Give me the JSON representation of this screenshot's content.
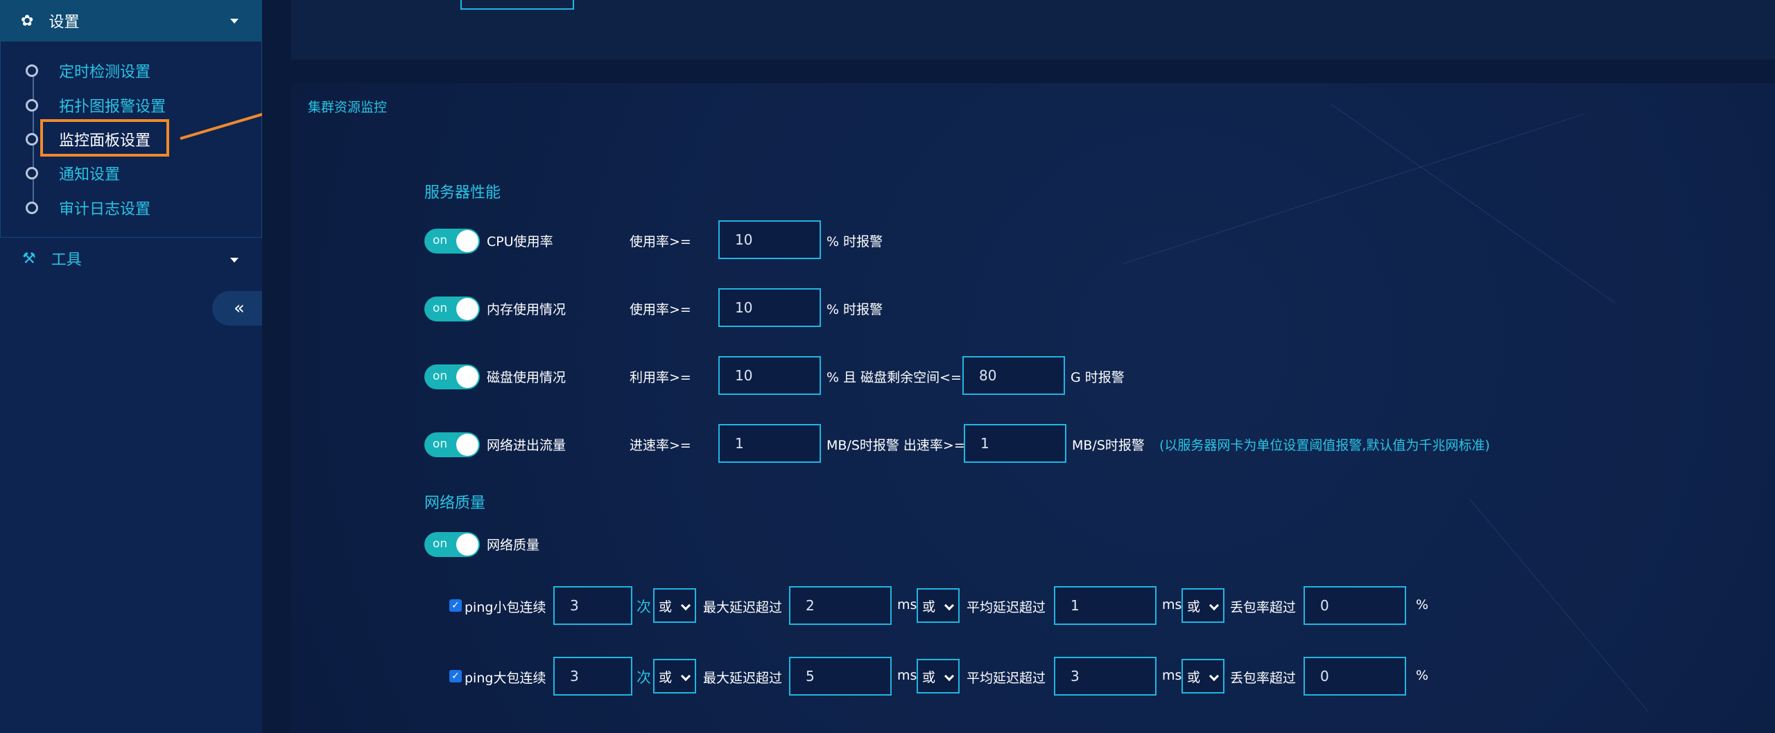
{
  "sidebar": {
    "settings_title": "设置",
    "settings_icon": "gear-icon",
    "items": [
      {
        "label": "定时检测设置"
      },
      {
        "label": "拓扑图报警设置"
      },
      {
        "label": "监控面板设置"
      },
      {
        "label": "通知设置"
      },
      {
        "label": "审计日志设置"
      }
    ],
    "tools_title": "工具",
    "tools_icon": "wrench-icon",
    "collapse_label": "«"
  },
  "panel": {
    "title": "集群资源监控",
    "server_section": "服务器性能",
    "network_section": "网络质量",
    "toggle_on": "on",
    "cpu": {
      "label": "CPU使用率",
      "prefix": "使用率>=",
      "value": "10",
      "suffix": "% 时报警"
    },
    "mem": {
      "label": "内存使用情况",
      "prefix": "使用率>=",
      "value": "10",
      "suffix": "% 时报警"
    },
    "disk": {
      "label": "磁盘使用情况",
      "prefix": "利用率>=",
      "value": "10",
      "mid": "% 且 磁盘剩余空间<=",
      "free_value": "80",
      "suffix": "G 时报警"
    },
    "net": {
      "label": "网络进出流量",
      "in_prefix": "进速率>=",
      "in_value": "1",
      "mid": "MB/S时报警 出速率>=",
      "out_value": "1",
      "suffix": "MB/S时报警",
      "note": "(以服务器网卡为单位设置阈值报警,默认值为千兆网标准)"
    },
    "netq": {
      "label": "网络质量"
    },
    "ping_small": {
      "label": "ping小包连续",
      "count": "3",
      "count_unit": "次",
      "or1": "或",
      "max_label": "最大延迟超过",
      "max_value": "2",
      "ms1": "ms",
      "or2": "或",
      "avg_label": "平均延迟超过",
      "avg_value": "1",
      "ms2": "ms",
      "or3": "或",
      "loss_label": "丢包率超过",
      "loss_value": "0",
      "pct": "%"
    },
    "ping_large": {
      "label": "ping大包连续",
      "count": "3",
      "count_unit": "次",
      "or1": "或",
      "max_label": "最大延迟超过",
      "max_value": "5",
      "ms1": "ms",
      "or2": "或",
      "avg_label": "平均延迟超过",
      "avg_value": "3",
      "ms2": "ms",
      "or3": "或",
      "loss_label": "丢包率超过",
      "loss_value": "0",
      "pct": "%"
    }
  },
  "colors": {
    "accent": "#2ac4e4",
    "toggle": "#18b2b8",
    "highlight": "#ef8a2a"
  }
}
